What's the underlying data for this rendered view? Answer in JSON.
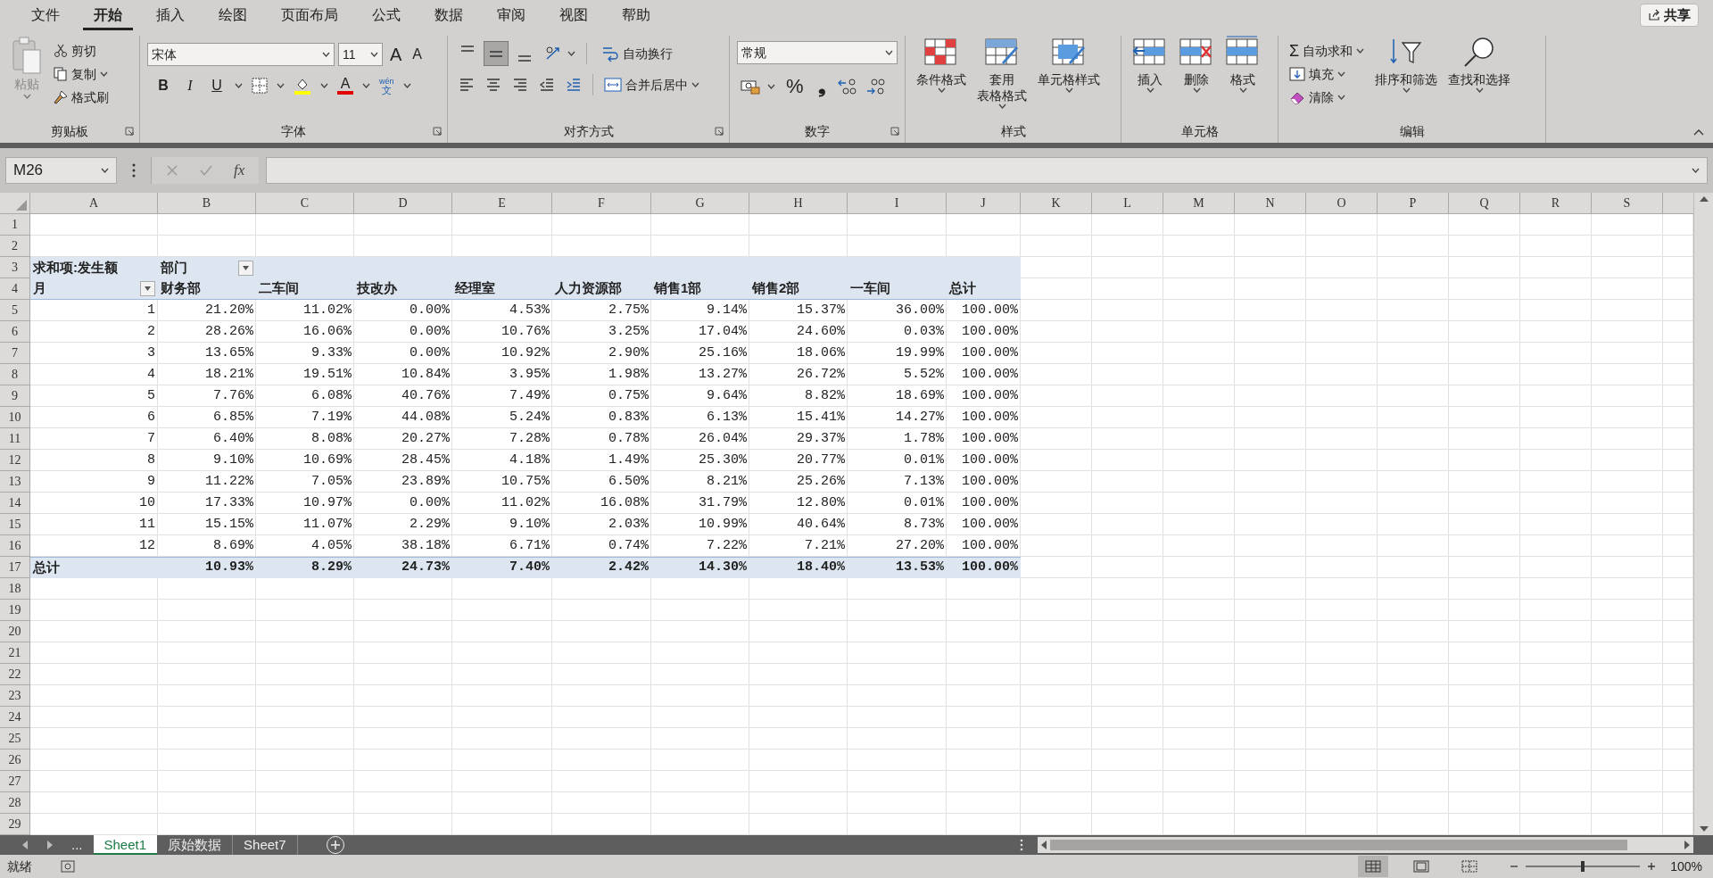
{
  "menu_tabs": [
    {
      "label": "文件",
      "selected": false
    },
    {
      "label": "开始",
      "selected": true
    },
    {
      "label": "插入",
      "selected": false
    },
    {
      "label": "绘图",
      "selected": false
    },
    {
      "label": "页面布局",
      "selected": false
    },
    {
      "label": "公式",
      "selected": false
    },
    {
      "label": "数据",
      "selected": false
    },
    {
      "label": "审阅",
      "selected": false
    },
    {
      "label": "视图",
      "selected": false
    },
    {
      "label": "帮助",
      "selected": false
    }
  ],
  "share_button": "共享",
  "clipboard": {
    "paste": {
      "label": "粘贴",
      "disabled": true
    },
    "cut": "剪切",
    "copy": "复制",
    "format_painter": "格式刷",
    "label": "剪贴板"
  },
  "font": {
    "font_name": "宋体",
    "font_size": "11",
    "grow": "A",
    "shrink": "A",
    "bold": "B",
    "italic": "I",
    "underline": "U",
    "font_color": "A",
    "phonetic": [
      "wén",
      "文"
    ],
    "label": "字体"
  },
  "alignment": {
    "vertical": [
      {
        "selected": false
      },
      {
        "selected": true
      },
      {
        "selected": false
      }
    ],
    "wrap_text": "自动换行",
    "merge_center": "合并后居中",
    "label": "对齐方式"
  },
  "number": {
    "format": "常规",
    "percent": "%",
    "comma": "❟",
    "label": "数字"
  },
  "styles": {
    "conditional": "条件格式",
    "table": [
      "套用",
      "表格格式"
    ],
    "cell_styles": "单元格样式",
    "label": "样式"
  },
  "cells": {
    "insert": "插入",
    "delete": "删除",
    "format": "格式",
    "label": "单元格"
  },
  "editing": {
    "sigma": "Σ",
    "autosum": "自动求和",
    "fill": "填充",
    "clear": "清除",
    "sort_filter": "排序和筛选",
    "find_select": "查找和选择",
    "label": "编辑"
  },
  "formula_bar": {
    "name_box": "M26",
    "fx": "fx"
  },
  "columns": [
    "A",
    "B",
    "C",
    "D",
    "E",
    "F",
    "G",
    "H",
    "I",
    "J",
    "K",
    "L",
    "M",
    "N",
    "O",
    "P",
    "Q",
    "R",
    "S"
  ],
  "row_numbers": [
    "1",
    "2",
    "3",
    "4",
    "5",
    "6",
    "7",
    "8",
    "9",
    "10",
    "11",
    "12",
    "13",
    "14",
    "15",
    "16",
    "17",
    "18",
    "19",
    "20",
    "21",
    "22",
    "23",
    "24",
    "25",
    "26",
    "27",
    "28",
    "29"
  ],
  "pivot": {
    "value_label": "求和项:发生额",
    "column_field": "部门",
    "row_field": "月",
    "departments": [
      "财务部",
      "二车间",
      "技改办",
      "经理室",
      "人力资源部",
      "销售1部",
      "销售2部",
      "一车间",
      "总计"
    ],
    "rows": [
      {
        "month": "1",
        "values": [
          "21.20%",
          "11.02%",
          "0.00%",
          "4.53%",
          "2.75%",
          "9.14%",
          "15.37%",
          "36.00%",
          "100.00%"
        ]
      },
      {
        "month": "2",
        "values": [
          "28.26%",
          "16.06%",
          "0.00%",
          "10.76%",
          "3.25%",
          "17.04%",
          "24.60%",
          "0.03%",
          "100.00%"
        ]
      },
      {
        "month": "3",
        "values": [
          "13.65%",
          "9.33%",
          "0.00%",
          "10.92%",
          "2.90%",
          "25.16%",
          "18.06%",
          "19.99%",
          "100.00%"
        ]
      },
      {
        "month": "4",
        "values": [
          "18.21%",
          "19.51%",
          "10.84%",
          "3.95%",
          "1.98%",
          "13.27%",
          "26.72%",
          "5.52%",
          "100.00%"
        ]
      },
      {
        "month": "5",
        "values": [
          "7.76%",
          "6.08%",
          "40.76%",
          "7.49%",
          "0.75%",
          "9.64%",
          "8.82%",
          "18.69%",
          "100.00%"
        ]
      },
      {
        "month": "6",
        "values": [
          "6.85%",
          "7.19%",
          "44.08%",
          "5.24%",
          "0.83%",
          "6.13%",
          "15.41%",
          "14.27%",
          "100.00%"
        ]
      },
      {
        "month": "7",
        "values": [
          "6.40%",
          "8.08%",
          "20.27%",
          "7.28%",
          "0.78%",
          "26.04%",
          "29.37%",
          "1.78%",
          "100.00%"
        ]
      },
      {
        "month": "8",
        "values": [
          "9.10%",
          "10.69%",
          "28.45%",
          "4.18%",
          "1.49%",
          "25.30%",
          "20.77%",
          "0.01%",
          "100.00%"
        ]
      },
      {
        "month": "9",
        "values": [
          "11.22%",
          "7.05%",
          "23.89%",
          "10.75%",
          "6.50%",
          "8.21%",
          "25.26%",
          "7.13%",
          "100.00%"
        ]
      },
      {
        "month": "10",
        "values": [
          "17.33%",
          "10.97%",
          "0.00%",
          "11.02%",
          "16.08%",
          "31.79%",
          "12.80%",
          "0.01%",
          "100.00%"
        ]
      },
      {
        "month": "11",
        "values": [
          "15.15%",
          "11.07%",
          "2.29%",
          "9.10%",
          "2.03%",
          "10.99%",
          "40.64%",
          "8.73%",
          "100.00%"
        ]
      },
      {
        "month": "12",
        "values": [
          "8.69%",
          "4.05%",
          "38.18%",
          "6.71%",
          "0.74%",
          "7.22%",
          "7.21%",
          "27.20%",
          "100.00%"
        ]
      }
    ],
    "total": {
      "label": "总计",
      "values": [
        "10.93%",
        "8.29%",
        "24.73%",
        "7.40%",
        "2.42%",
        "14.30%",
        "18.40%",
        "13.53%",
        "100.00%"
      ]
    }
  },
  "sheet_nav": "...",
  "sheet_tabs": [
    {
      "label": "Sheet1",
      "selected": true
    },
    {
      "label": "原始数据",
      "selected": false
    },
    {
      "label": "Sheet7",
      "selected": false
    }
  ],
  "status_bar": {
    "text": "就绪",
    "zoom": "100%",
    "zoom_slider": {
      "level": 0.5
    },
    "views": [
      {
        "selected": true
      },
      {
        "selected": false
      },
      {
        "selected": false
      }
    ]
  }
}
